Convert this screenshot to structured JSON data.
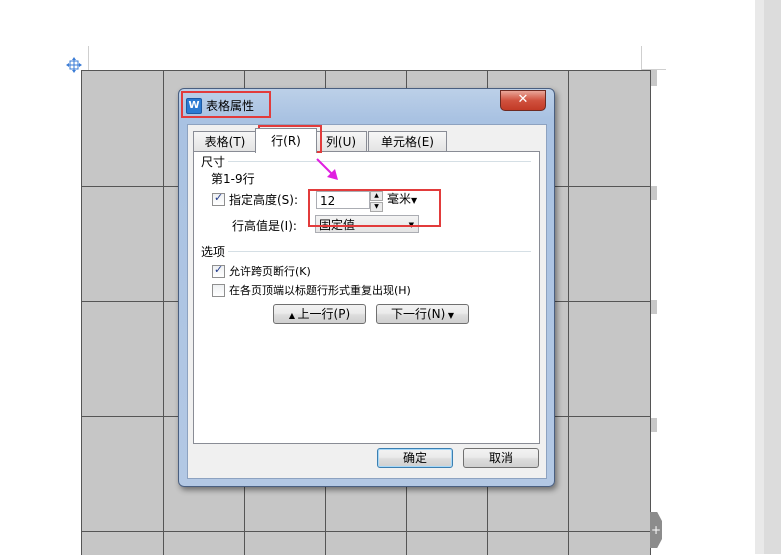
{
  "dialog": {
    "title": "表格属性",
    "close_glyph": "✕",
    "tabs": [
      {
        "label": "表格(T)"
      },
      {
        "label": "行(R)"
      },
      {
        "label": "列(U)"
      },
      {
        "label": "单元格(E)"
      }
    ],
    "size_section": {
      "label": "尺寸",
      "rows_caption": "第1-9行",
      "specify_height_label": "指定高度(S):",
      "specify_height_checked": true,
      "height_value": "12",
      "unit": "毫米",
      "row_height_is_label": "行高值是(I):",
      "row_height_is_value": "固定值"
    },
    "options_section": {
      "label": "选项",
      "allow_break_label": "允许跨页断行(K)",
      "allow_break_checked": true,
      "repeat_header_label": "在各页顶端以标题行形式重复出现(H)",
      "repeat_header_checked": false,
      "prev_row_button": "上一行(P)",
      "next_row_button": "下一行(N)"
    },
    "ok_button": "确定",
    "cancel_button": "取消"
  },
  "document": {
    "expand_glyph": "+"
  },
  "colors": {
    "annotation_red": "#e23b3b",
    "arrow_magenta": "#e020e0",
    "table_fill": "#c6c6c6"
  }
}
